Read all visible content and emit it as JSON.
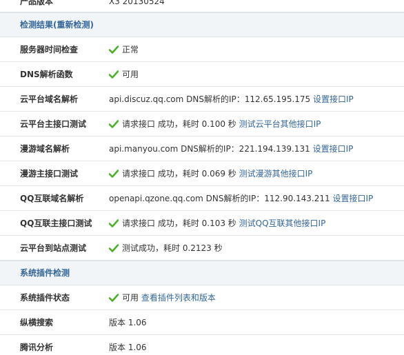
{
  "product_version": {
    "label": "产品版本",
    "value": "X3 20130524"
  },
  "section1": {
    "title": "检测结果",
    "recheck": "(重新检测)"
  },
  "rows": [
    {
      "label": "服务器时间检查",
      "status": "正常"
    },
    {
      "label": "DNS解析函数",
      "status": "可用"
    },
    {
      "label": "云平台域名解析",
      "text": "api.discuz.qq.com DNS解析的IP：112.65.195.175",
      "link": "设置接口IP"
    },
    {
      "label": "云平台主接口测试",
      "status": "请求接口 成功，耗时 0.100 秒",
      "link": "测试云平台其他接口IP"
    },
    {
      "label": "漫游域名解析",
      "text": "api.manyou.com DNS解析的IP：221.194.139.131",
      "link": "设置接口IP"
    },
    {
      "label": "漫游主接口测试",
      "status": "请求接口 成功，耗时 0.069 秒",
      "link": "测试漫游其他接口IP"
    },
    {
      "label": "QQ互联域名解析",
      "text": "openapi.qzone.qq.com DNS解析的IP：112.90.143.211",
      "link": "设置接口IP"
    },
    {
      "label": "QQ互联主接口测试",
      "status": "请求接口 成功，耗时 0.103 秒",
      "link": "测试QQ互联其他接口IP"
    },
    {
      "label": "云平台到站点测试",
      "status": "测试成功，耗时 0.2123 秒"
    }
  ],
  "section2": {
    "title": "系统插件检测"
  },
  "plugin_rows": [
    {
      "label": "系统插件状态",
      "status": "可用",
      "link": "查看插件列表和版本"
    },
    {
      "label": "纵横搜索",
      "text": "版本 1.06"
    },
    {
      "label": "腾讯分析",
      "text": "版本 1.06"
    }
  ],
  "colors": {
    "accent": "#336699",
    "check": "#4caf2a",
    "section_bg": "#f2f5f8"
  }
}
